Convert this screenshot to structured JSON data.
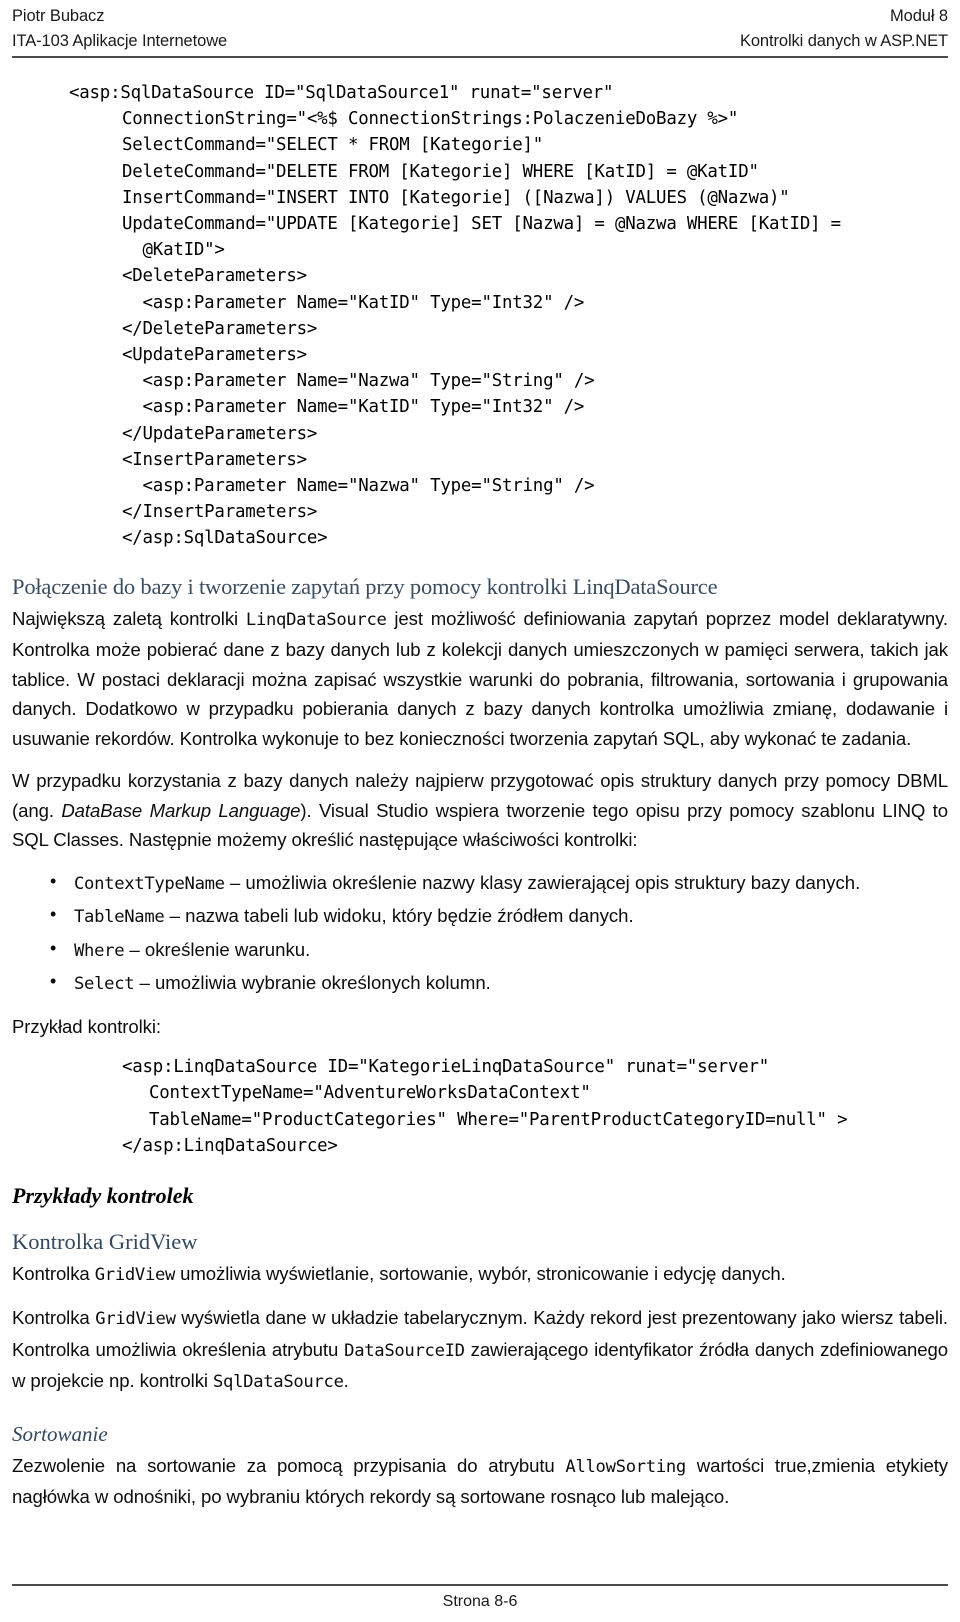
{
  "header": {
    "left_line1": "Piotr Bubacz",
    "left_line2": "ITA-103 Aplikacje Internetowe",
    "right_line1": "Moduł 8",
    "right_line2": "Kontrolki danych w ASP.NET"
  },
  "code_sql_datasource": {
    "line1": "<asp:SqlDataSource ID=\"SqlDataSource1\" runat=\"server\"",
    "line2": "ConnectionString=\"<%$ ConnectionStrings:PolaczenieDoBazy %>\"\nSelectCommand=\"SELECT * FROM [Kategorie]\"\nDeleteCommand=\"DELETE FROM [Kategorie] WHERE [KatID] = @KatID\"\nInsertCommand=\"INSERT INTO [Kategorie] ([Nazwa]) VALUES (@Nazwa)\"\nUpdateCommand=\"UPDATE [Kategorie] SET [Nazwa] = @Nazwa WHERE [KatID] =\n  @KatID\">\n<DeleteParameters>\n  <asp:Parameter Name=\"KatID\" Type=\"Int32\" />\n</DeleteParameters>\n<UpdateParameters>\n  <asp:Parameter Name=\"Nazwa\" Type=\"String\" />\n  <asp:Parameter Name=\"KatID\" Type=\"Int32\" />\n</UpdateParameters>\n<InsertParameters>\n  <asp:Parameter Name=\"Nazwa\" Type=\"String\" />\n</InsertParameters>\n</asp:SqlDataSource>"
  },
  "section_linq": {
    "heading": "Połączenie do bazy i tworzenie zapytań przy pomocy kontrolki LinqDataSource",
    "para1_a": "Największą zaletą kontrolki ",
    "para1_code": "LinqDataSource",
    "para1_b": " jest możliwość definiowania zapytań poprzez model deklaratywny. Kontrolka może pobierać dane z bazy danych lub z kolekcji danych umieszczonych w pamięci serwera, takich jak tablice. W postaci deklaracji można zapisać wszystkie warunki do pobrania, filtrowania, sortowania i grupowania danych. Dodatkowo w przypadku pobierania danych z bazy danych kontrolka umożliwia zmianę, dodawanie i usuwanie rekordów. Kontrolka wykonuje to bez konieczności tworzenia zapytań SQL, aby wykonać te zadania.",
    "para2_a": "W przypadku korzystania z bazy danych należy najpierw przygotować opis struktury danych przy pomocy DBML (ang. ",
    "para2_italic": "DataBase Markup Language",
    "para2_b": "). Visual Studio wspiera tworzenie tego opisu przy pomocy szablonu LINQ to SQL Classes. Następnie możemy określić następujące właściwości kontrolki:",
    "properties": [
      {
        "name": "ContextTypeName",
        "desc": " – umożliwia określenie nazwy klasy zawierającej opis struktury bazy danych."
      },
      {
        "name": "TableName",
        "desc": " – nazwa tabeli lub widoku, który będzie źródłem danych."
      },
      {
        "name": "Where",
        "desc": " – określenie warunku."
      },
      {
        "name": "Select",
        "desc": " – umożliwia wybranie określonych kolumn."
      }
    ],
    "example_label": "Przykład kontrolki:"
  },
  "code_linq_datasource": {
    "line1": "<asp:LinqDataSource ID=\"KategorieLinqDataSource\" runat=\"server\"",
    "rest": "ContextTypeName=\"AdventureWorksDataContext\"\nTableName=\"ProductCategories\" Where=\"ParentProductCategoryID=null\" >",
    "close": "</asp:LinqDataSource>"
  },
  "section_examples": {
    "heading": "Przykłady kontrolek",
    "gridview_heading": "Kontrolka GridView",
    "gridview_para1_a": "Kontrolka ",
    "gridview_para1_code": "GridView",
    "gridview_para1_b": " umożliwia wyświetlanie, sortowanie, wybór, stronicowanie i edycję danych.",
    "gridview_para2_a": "Kontrolka ",
    "gridview_para2_code1": "GridView",
    "gridview_para2_b": " wyświetla dane w układzie tabelarycznym. Każdy rekord jest prezentowany jako wiersz tabeli. Kontrolka umożliwia określenia atrybutu ",
    "gridview_para2_code2": "DataSourceID",
    "gridview_para2_c": " zawierającego identyfikator źródła danych zdefiniowanego w projekcie np. kontrolki ",
    "gridview_para2_code3": "SqlDataSource",
    "gridview_para2_d": ".",
    "sorting_heading": "Sortowanie",
    "sorting_para_a": "Zezwolenie na sortowanie za pomocą przypisania do atrybutu ",
    "sorting_para_code": "AllowSorting",
    "sorting_para_b": " wartości true,zmienia etykiety nagłówka w odnośniki, po wybraniu których rekordy są sortowane rosnąco lub malejąco."
  },
  "footer": {
    "page_label": "Strona 8-6"
  },
  "colors": {
    "heading_blue": "#3b4c5e",
    "subheading_blue": "#33475e",
    "rule_gray": "#4a4a4a",
    "body_black": "#0d0d0d"
  }
}
